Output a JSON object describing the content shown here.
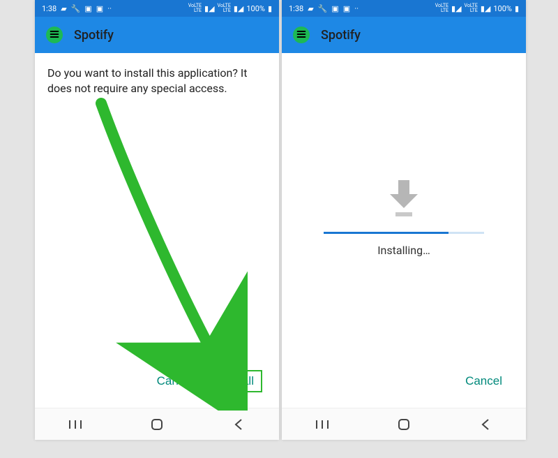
{
  "status": {
    "time": "1:38",
    "net1": "VoLTE",
    "net2": "LTE",
    "battery_pct": "100%"
  },
  "header": {
    "app_name": "Spotify"
  },
  "prompt": {
    "message": "Do you want to install this application? It does not require any special access.",
    "cancel_label": "Cancel",
    "install_label": "Install"
  },
  "installing": {
    "label": "Installing…",
    "progress_pct": 78,
    "cancel_label": "Cancel"
  },
  "colors": {
    "accent": "#1976d2",
    "brand": "#1db954",
    "action": "#00897b",
    "highlight": "#2eb82e"
  }
}
